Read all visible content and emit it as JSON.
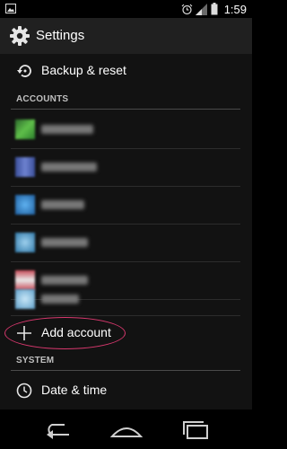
{
  "status_bar": {
    "time": "1:59",
    "left_icon": "gallery-notification-icon",
    "right_icons": [
      "alarm-icon",
      "signal-icon",
      "battery-icon"
    ]
  },
  "action_bar": {
    "title": "Settings",
    "icon": "gear-icon"
  },
  "list": {
    "backup_reset": {
      "label": "Backup & reset",
      "icon": "restore-icon"
    },
    "accounts_header": "ACCOUNTS",
    "accounts": [
      {
        "icon": "blurred-account-icon-green",
        "color": "#3f8f3f"
      },
      {
        "icon": "blurred-account-icon-blue",
        "color": "#4a5fae"
      },
      {
        "icon": "blurred-account-icon-azure",
        "color": "#2f7fc4"
      },
      {
        "icon": "blurred-account-icon-teal",
        "color": "#3a86b8"
      },
      {
        "icon": "blurred-account-icon-red",
        "color": "#c9535e"
      },
      {
        "icon": "blurred-account-icon-lightblue",
        "color": "#6faad0"
      }
    ],
    "add_account": {
      "label": "Add account",
      "icon": "plus-icon"
    },
    "system_header": "SYSTEM",
    "date_time": {
      "label": "Date & time",
      "icon": "clock-icon"
    }
  },
  "nav_bar": {
    "icons": [
      "back-icon",
      "home-icon",
      "recents-icon"
    ]
  },
  "colors": {
    "highlight_ellipse": "#d8386e",
    "action_bar_bg": "#202020",
    "content_bg": "#121212"
  }
}
